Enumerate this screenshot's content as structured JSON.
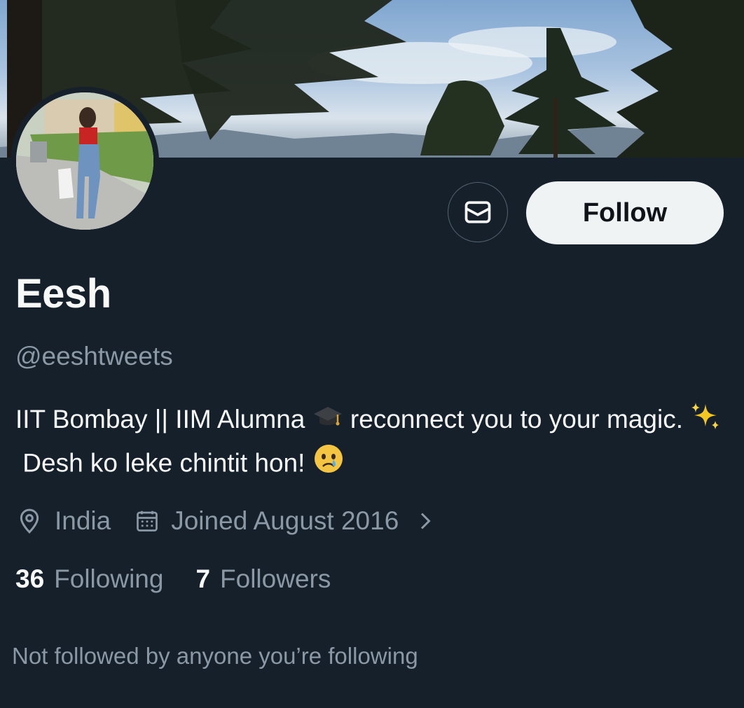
{
  "profile": {
    "name": "Eesh",
    "handle": "@eeshtweets",
    "bio_part1": "IIT Bombay || IIM Alumna",
    "bio_part2": "reconnect you to your magic.",
    "bio_part3": "Desh ko leke chintit hon!",
    "location": "India",
    "joined": "Joined August 2016",
    "following_count": "36",
    "following_label": "Following",
    "followers_count": "7",
    "followers_label": "Followers",
    "followed_by_note": "Not followed by anyone you’re following"
  },
  "actions": {
    "follow_label": "Follow",
    "message_icon": "envelope-icon"
  },
  "icons": {
    "location": "location-pin-icon",
    "calendar": "calendar-icon",
    "chevron": "chevron-right-icon",
    "graduation": "graduation-cap-emoji",
    "sparkles": "sparkles-emoji",
    "crying": "crying-face-emoji"
  },
  "colors": {
    "background": "#15202b",
    "text_primary": "#f7f9f9",
    "text_secondary": "#8b98a5",
    "follow_button_bg": "#eff3f4",
    "follow_button_text": "#0f1419"
  }
}
